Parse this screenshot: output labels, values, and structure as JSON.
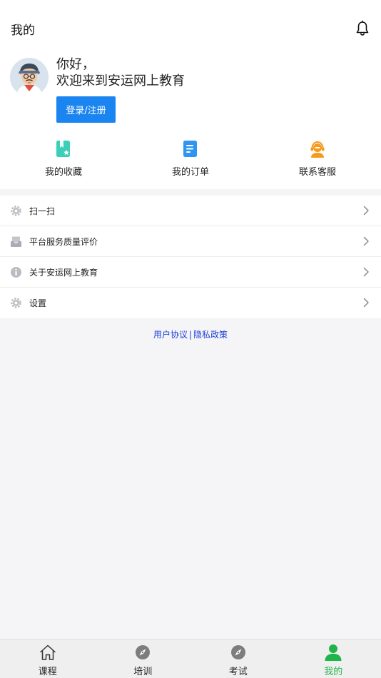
{
  "header": {
    "title": "我的"
  },
  "profile": {
    "greeting": "你好，",
    "welcome": "欢迎来到安运网上教育",
    "login_label": "登录/注册"
  },
  "quick_actions": [
    {
      "label": "我的收藏",
      "icon": "favorites-icon",
      "color": "#3ccfb7"
    },
    {
      "label": "我的订单",
      "icon": "orders-icon",
      "color": "#2f95f2"
    },
    {
      "label": "联系客服",
      "icon": "customer-service-icon",
      "color": "#f59a1c"
    }
  ],
  "menu": [
    {
      "label": "扫一扫",
      "icon": "gear-icon"
    },
    {
      "label": "平台服务质量评价",
      "icon": "inbox-icon"
    },
    {
      "label": "关于安运网上教育",
      "icon": "info-icon"
    },
    {
      "label": "设置",
      "icon": "gear-icon"
    }
  ],
  "links": {
    "user_agreement": "用户协议",
    "separator": "|",
    "privacy_policy": "隐私政策"
  },
  "tabbar": [
    {
      "label": "课程",
      "icon": "home-icon",
      "active": false
    },
    {
      "label": "培训",
      "icon": "compass-icon",
      "active": false
    },
    {
      "label": "考试",
      "icon": "compass-icon",
      "active": false
    },
    {
      "label": "我的",
      "icon": "user-icon",
      "active": true
    }
  ],
  "colors": {
    "accent": "#1a84f0",
    "active_tab": "#1fb54a",
    "link": "#1e3fd8"
  }
}
